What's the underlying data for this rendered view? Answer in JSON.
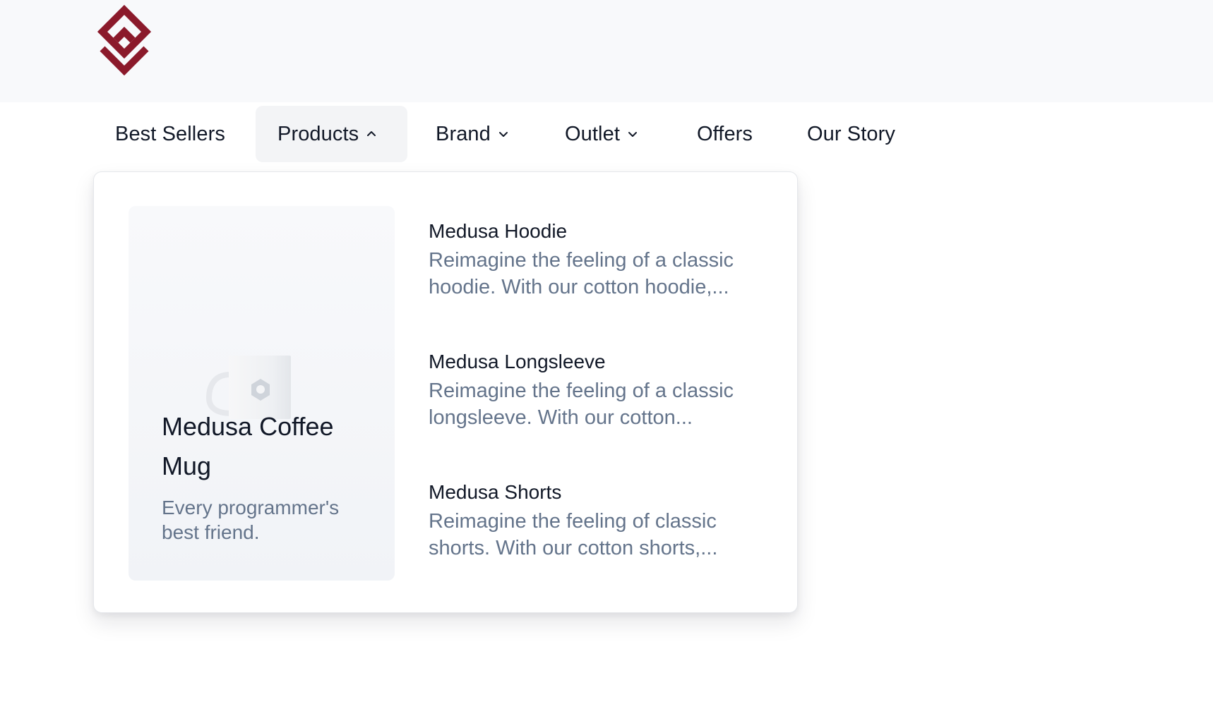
{
  "brand": {
    "logo_icon": "medusa-diamond-logo-icon",
    "accent_color": "#8b1a2b"
  },
  "nav": {
    "items": [
      {
        "label": "Best Sellers",
        "has_menu": false
      },
      {
        "label": "Products",
        "has_menu": true,
        "open": true
      },
      {
        "label": "Brand",
        "has_menu": true
      },
      {
        "label": "Outlet",
        "has_menu": true
      },
      {
        "label": "Offers",
        "has_menu": false
      },
      {
        "label": "Our Story",
        "has_menu": false
      }
    ]
  },
  "products_menu": {
    "featured": {
      "title": "Medusa Coffee Mug",
      "description": "Every programmer's best friend.",
      "image_icon": "coffee-mug-icon"
    },
    "items": [
      {
        "name": "Medusa Hoodie",
        "description": "Reimagine the feeling of a classic hoodie. With our cotton hoodie,..."
      },
      {
        "name": "Medusa Longsleeve",
        "description": "Reimagine the feeling of a classic longsleeve. With our cotton..."
      },
      {
        "name": "Medusa Shorts",
        "description": "Reimagine the feeling of classic shorts. With our cotton shorts,..."
      }
    ]
  }
}
